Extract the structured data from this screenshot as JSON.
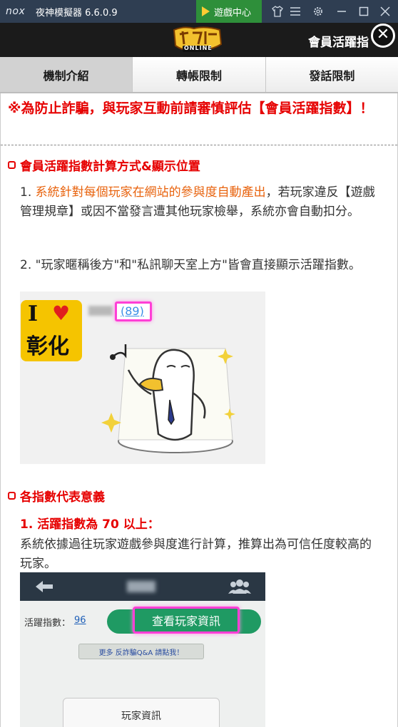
{
  "titlebar": {
    "brand": "nox",
    "app_title": "夜神模擬器 6.6.0.9",
    "game_center": "遊戲中心"
  },
  "header": {
    "logo_text": "ONLINE",
    "title": "會員活躍指",
    "close": "✕"
  },
  "tabs": [
    {
      "label": "機制介紹",
      "active": true
    },
    {
      "label": "轉帳限制",
      "active": false
    },
    {
      "label": "發話限制",
      "active": false
    }
  ],
  "warning": "※為防止詐騙，與玩家互動前請審慎評估【會員活躍指數】！",
  "section1": {
    "title": "會員活躍指數計算方式&顯示位置",
    "p1_highlight": "系統針對每個玩家在網站的參與度自動產出",
    "p1_prefix": "1. ",
    "p1_rest": "，若玩家違反【遊戲管理規章】或因不當發言遭其他玩家檢舉，系統亦會自動扣分。",
    "p2": "2. \"玩家暱稱後方\"和\"私訊聊天室上方\"皆會直接顯示活躍指數。",
    "image1": {
      "avatar_line1": "I",
      "avatar_line2": "彰化",
      "score": "(89)"
    }
  },
  "section2": {
    "title": "各指數代表意義",
    "sub1": "1. 活躍指數為 70 以上：",
    "p1": "系統依據過往玩家遊戲參與度進行計算，推算出為可信任度較高的玩家。",
    "image2": {
      "activity_label": "活躍指數：",
      "activity_value": "96",
      "view_button": "查看玩家資訊",
      "fraud_link": "更多 反詐騙Q&A 請點我！",
      "player_info": "玩家資訊"
    }
  },
  "colors": {
    "red": "#e60000",
    "orange": "#e8620c",
    "titlebar": "#2f3e52",
    "game_center": "#2e8f3a"
  }
}
